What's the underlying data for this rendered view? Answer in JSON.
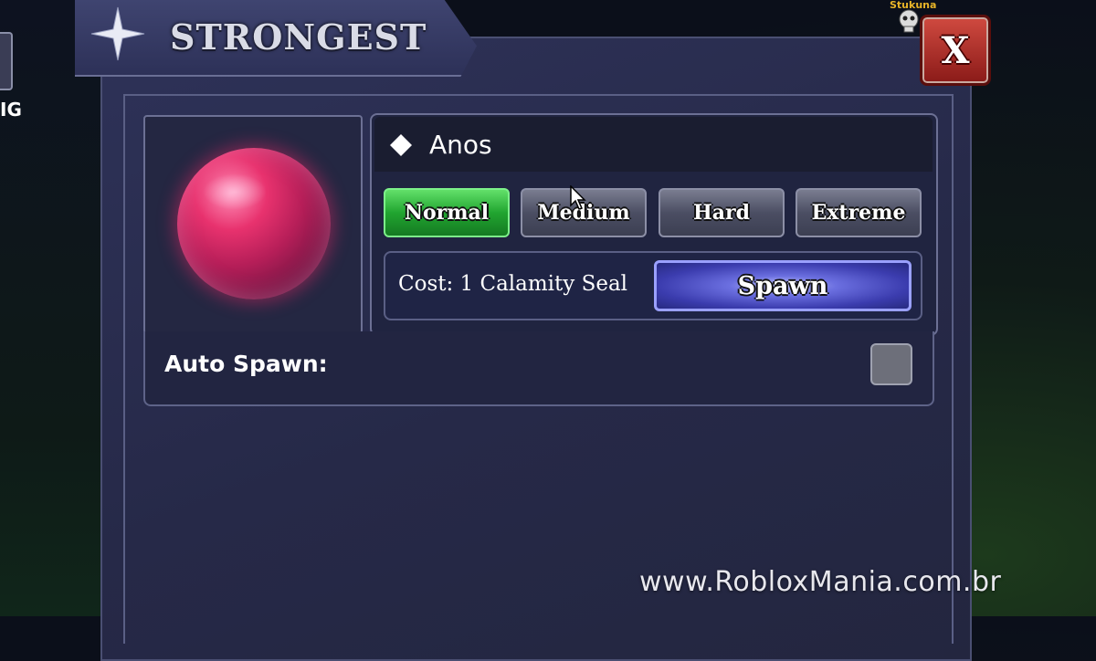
{
  "left_edge": {
    "text": "IG"
  },
  "header": {
    "title": "STRONGEST"
  },
  "close_button": {
    "label": "X"
  },
  "top_right_badge": {
    "label": "Stukuna"
  },
  "boss": {
    "name": "Anos"
  },
  "difficulties": [
    {
      "label": "Normal",
      "selected": true
    },
    {
      "label": "Medium",
      "selected": false
    },
    {
      "label": "Hard",
      "selected": false
    },
    {
      "label": "Extreme",
      "selected": false
    }
  ],
  "cost": {
    "text": "Cost: 1 Calamity Seal"
  },
  "spawn_button": {
    "label": "Spawn"
  },
  "auto_spawn": {
    "label": "Auto Spawn:",
    "checked": false
  },
  "watermark": "www.RobloxMania.com.br",
  "colors": {
    "selected_difficulty": "#21a530",
    "spawn_button": "#5a5ed0",
    "close_button": "#b0302a",
    "orb": "#e8326e"
  }
}
